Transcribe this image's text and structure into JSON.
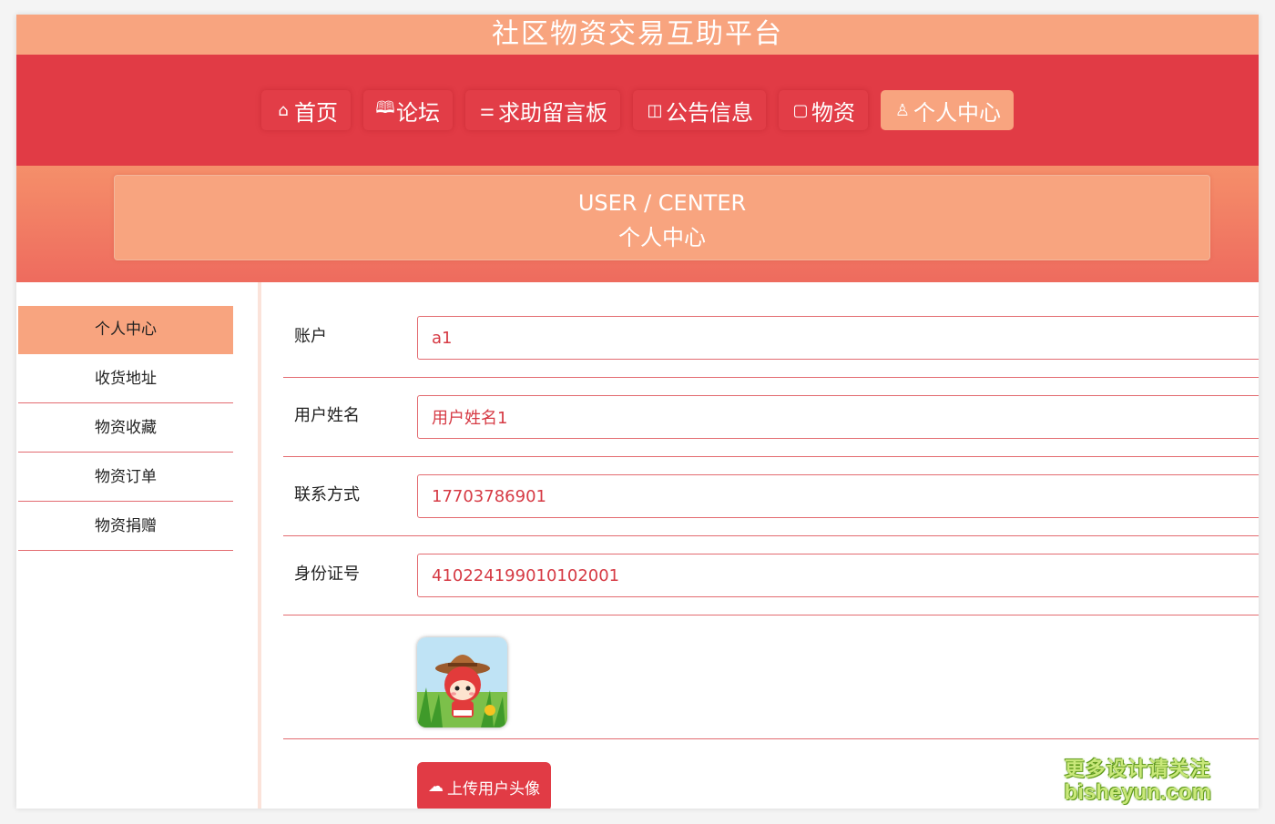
{
  "header": {
    "title": "社区物资交易互助平台"
  },
  "nav": {
    "items": [
      {
        "icon": "home-icon",
        "glyph": "⌂",
        "label": "首页"
      },
      {
        "icon": "book-icon",
        "glyph": "🕮",
        "label": "论坛"
      },
      {
        "icon": "sliders-icon",
        "glyph": "⚌",
        "label": "求助留言板"
      },
      {
        "icon": "notice-icon",
        "glyph": "◫",
        "label": "公告信息"
      },
      {
        "icon": "document-icon",
        "glyph": "▢",
        "label": "物资"
      },
      {
        "icon": "user-icon",
        "glyph": "♙",
        "label": "个人中心",
        "active": true
      }
    ]
  },
  "banner": {
    "en": "USER / CENTER",
    "cn": "个人中心"
  },
  "sidebar": {
    "items": [
      {
        "label": "个人中心",
        "active": true
      },
      {
        "label": "收货地址"
      },
      {
        "label": "物资收藏"
      },
      {
        "label": "物资订单"
      },
      {
        "label": "物资捐赠"
      }
    ]
  },
  "form": {
    "account": {
      "label": "账户",
      "value": "a1"
    },
    "name": {
      "label": "用户姓名",
      "value": "用户姓名1"
    },
    "phone": {
      "label": "联系方式",
      "value": "17703786901"
    },
    "idcard": {
      "label": "身份证号",
      "value": "410224199010102001"
    },
    "upload_label": "上传用户头像"
  },
  "watermark": {
    "line1": "更多设计请关注",
    "line2": "bisheyun.com"
  },
  "colors": {
    "primary": "#e13b45",
    "accent": "#f8a47f"
  }
}
